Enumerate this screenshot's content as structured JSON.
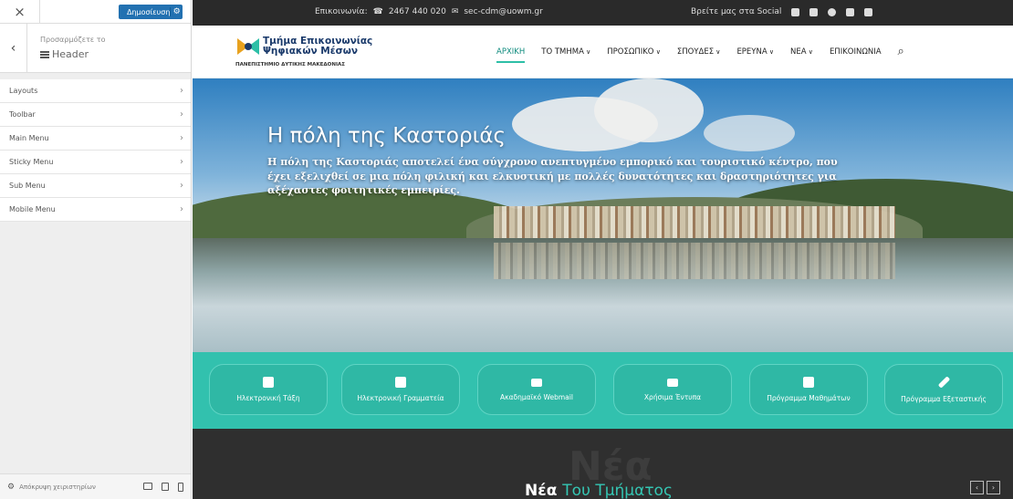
{
  "sidebar": {
    "close_glyph": "×",
    "publish_label": "Δημοσίευση",
    "gear_glyph": "⚙",
    "back_glyph": "‹",
    "customizing_label": "Προσαρμόζετε το",
    "section_title": "Header",
    "items": [
      {
        "label": "Layouts"
      },
      {
        "label": "Toolbar"
      },
      {
        "label": "Main Menu"
      },
      {
        "label": "Sticky Menu"
      },
      {
        "label": "Sub Menu"
      },
      {
        "label": "Mobile Menu"
      }
    ],
    "chevron_glyph": "›",
    "hide_controls_label": "Απόκρυψη χειριστηρίων"
  },
  "topbar": {
    "contact_label": "Επικοινωνία:",
    "phone": "2467 440 020",
    "email": "sec-cdm@uowm.gr",
    "social_label": "Βρείτε μας στα Social",
    "icons": [
      "facebook-icon",
      "twitter-icon",
      "instagram-icon",
      "youtube-icon",
      "mail-icon"
    ]
  },
  "logo": {
    "line1": "Τμήμα Επικοινωνίας",
    "line2": "Ψηφιακών Μέσων",
    "university": "ΠΑΝΕΠΙΣΤΗΜΙΟ ΔΥΤΙΚΗΣ ΜΑΚΕΔΟΝΙΑΣ"
  },
  "nav": {
    "items": [
      "ΑΡΧΙΚΗ",
      "ΤΟ ΤΜΗΜΑ",
      "ΠΡΟΣΩΠΙΚΟ",
      "ΣΠΟΥΔΕΣ",
      "ΕΡΕΥΝΑ",
      "ΝΕΑ",
      "ΕΠΙΚΟΙΝΩΝΙΑ"
    ],
    "active": "ΑΡΧΙΚΗ",
    "accent_color": "#2dbfa7"
  },
  "hero": {
    "title": "Η πόλη της Καστοριάς",
    "text": "Η πόλη της Καστοριάς αποτελεί ένα σύγχρονο ανεπτυγμένο εμπορικό και τουριστικό κέντρο, που έχει εξελιχθεί σε μια πόλη φιλική και ελκυστική με πολλές δυνατότητες και δραστηριότητες για αξέχαστες φοιτητικές εμπειρίες."
  },
  "quick_links": {
    "color": "#32c1ae",
    "items": [
      {
        "label": "Ηλεκτρονική Τάξη",
        "icon": "classroom-icon"
      },
      {
        "label": "Ηλεκτρονική Γραμματεία",
        "icon": "secretary-icon"
      },
      {
        "label": "Ακαδημαϊκό Webmail",
        "icon": "envelope-icon"
      },
      {
        "label": "Χρήσιμα Έντυπα",
        "icon": "folder-icon"
      },
      {
        "label": "Πρόγραμμα Μαθημάτων",
        "icon": "calendar-icon"
      },
      {
        "label": "Πρόγραμμα Εξεταστικής",
        "icon": "pencil-icon"
      }
    ]
  },
  "news": {
    "ghost": "Νέα",
    "title_main": "Νέα",
    "title_accent": "Του Τμήματος",
    "prev_glyph": "‹",
    "next_glyph": "›"
  }
}
